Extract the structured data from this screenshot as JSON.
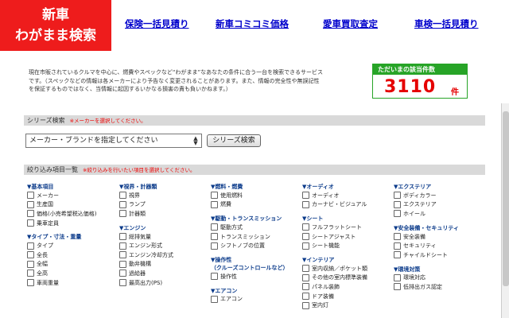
{
  "header": {
    "logo_line1": "新車",
    "logo_line2": "わがまま検索",
    "nav": [
      "保険一括見積り",
      "新車コミコミ価格",
      "愛車買取査定",
      "車検一括見積り"
    ]
  },
  "description": "現在市販されているクルマを中心に、燃費やスペックなど“わがまま”なあなたの条件に合う一台を検索できるサービスです。（スペックなどの情報は各メーカーにより予告なく変更されることがあります。また、情報の完全性や無誤記性を保証するものではなく、当情報に起因するいかなる損害の責も負いかねます。）",
  "count": {
    "label": "ただいまの該当件数",
    "value": "3110",
    "unit": "件"
  },
  "series_search": {
    "title": "シリーズ検索",
    "note": "※メーカーを選択してください。",
    "select_value": "メーカー・ブランドを指定してください",
    "button": "シリーズ検索"
  },
  "filter_section": {
    "title": "絞り込み項目一覧",
    "note": "※絞り込みを行いたい項目を選択してください。"
  },
  "filters": [
    {
      "groups": [
        {
          "title": "▼基本項目",
          "items": [
            "メーカー",
            "生産国",
            "価格(小売希望税込価格)",
            "乗車定員"
          ]
        },
        {
          "title": "▼タイプ・寸法・重量",
          "items": [
            "タイプ",
            "全長",
            "全幅",
            "全高",
            "車両重量"
          ]
        }
      ]
    },
    {
      "groups": [
        {
          "title": "▼視界・計器類",
          "items": [
            "視界",
            "ランプ",
            "計器類"
          ]
        },
        {
          "title": "▼エンジン",
          "items": [
            "総排気量",
            "エンジン形式",
            "エンジン冷却方式",
            "動弁機構",
            "過給器",
            "最高出力(PS)"
          ]
        }
      ]
    },
    {
      "groups": [
        {
          "title": "▼燃料・燃費",
          "items": [
            "使用燃料",
            "燃費"
          ]
        },
        {
          "title": "▼駆動・トランスミッション",
          "items": [
            "駆動方式",
            "トランスミッション",
            "シフトノブの位置"
          ]
        },
        {
          "title": "▼操作性",
          "sub": "（クルーズコントロールなど）",
          "items": [
            "操作性"
          ]
        },
        {
          "title": "▼エアコン",
          "items": [
            "エアコン"
          ]
        }
      ]
    },
    {
      "groups": [
        {
          "title": "▼オーディオ",
          "items": [
            "オーディオ",
            "カーナビ・ビジュアル"
          ]
        },
        {
          "title": "▼シート",
          "items": [
            "フルフラットシート",
            "シートアジャスト",
            "シート機能"
          ]
        },
        {
          "title": "▼インテリア",
          "items": [
            "室内収納／ポケット類",
            "その他の室内標準装備",
            "パネル装飾",
            "ドア装備",
            "室内灯"
          ]
        }
      ]
    },
    {
      "groups": [
        {
          "title": "▼エクステリア",
          "items": [
            "ボディカラー",
            "エクステリア",
            "ホイール"
          ]
        },
        {
          "title": "▼安全装備・セキュリティ",
          "items": [
            "安全装備",
            "セキュリティ",
            "チャイルドシート"
          ]
        },
        {
          "title": "▼環境対策",
          "items": [
            "環境対応",
            "低排出ガス認定"
          ]
        }
      ]
    }
  ]
}
